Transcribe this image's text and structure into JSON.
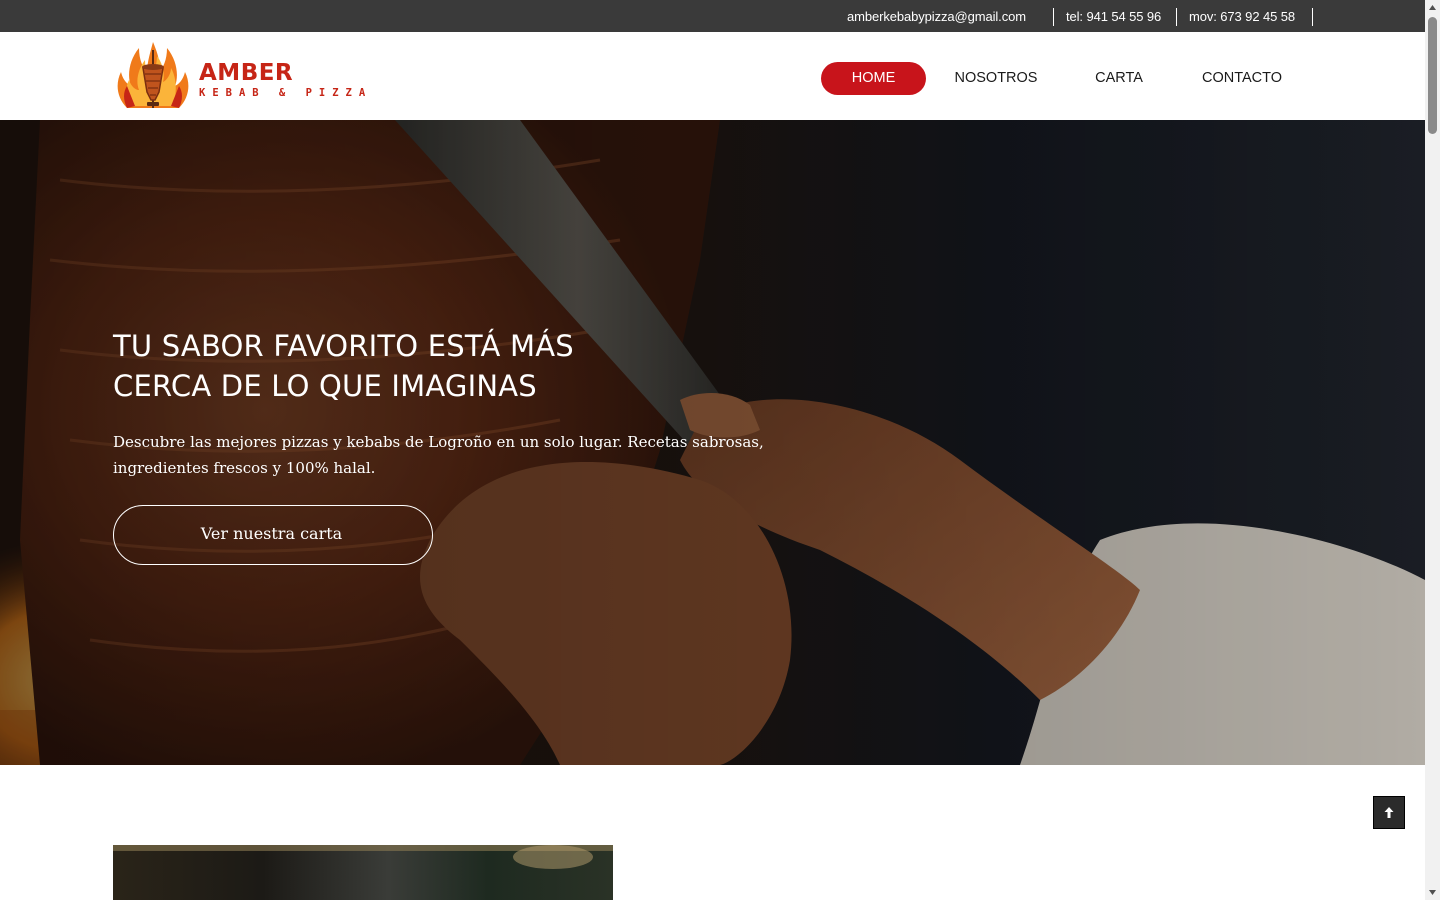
{
  "topbar": {
    "email": "amberkebabypizza@gmail.com",
    "phone": "tel: 941 54 55 96",
    "mobile": "mov: 673 92 45 58"
  },
  "brand": {
    "name": "AMBER",
    "tagline": "KEBAB & PIZZA"
  },
  "nav": {
    "items": [
      {
        "label": "HOME",
        "active": true
      },
      {
        "label": "NOSOTROS",
        "active": false
      },
      {
        "label": "CARTA",
        "active": false
      },
      {
        "label": "CONTACTO",
        "active": false
      }
    ]
  },
  "hero": {
    "title": "TU SABOR FAVORITO ESTÁ MÁS CERCA DE LO QUE IMAGINAS",
    "subtitle": "Descubre las mejores pizzas y kebabs de Logroño en un solo lugar. Recetas sabrosas, ingredientes frescos y 100% halal.",
    "cta_label": "Ver nuestra carta"
  },
  "icons": {
    "logo": "kebab-flame-logo",
    "scroll_top": "arrow-up-icon",
    "scrollbar_up": "triangle-up-icon",
    "scrollbar_down": "triangle-down-icon"
  },
  "colors": {
    "topbar": "#3a3a3a",
    "accent_red": "#c8141b",
    "brand_red": "#c62516",
    "text_dark": "#1a1a1a",
    "white": "#ffffff"
  }
}
